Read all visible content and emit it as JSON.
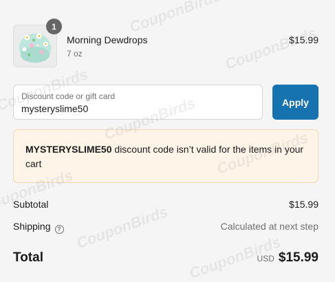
{
  "line_item": {
    "quantity": "1",
    "name": "Morning Dewdrops",
    "variant": "7 oz",
    "price": "$15.99",
    "thumbnail_icon": "slime-product-image"
  },
  "discount": {
    "label": "Discount code or gift card",
    "value": "mysteryslime50",
    "apply_label": "Apply"
  },
  "error": {
    "code": "MYSTERYSLIME50",
    "message": " discount code isn’t valid for the items in your cart"
  },
  "summary": {
    "subtotal_label": "Subtotal",
    "subtotal_value": "$15.99",
    "shipping_label": "Shipping",
    "shipping_help_icon": "question-circle-icon",
    "shipping_value": "Calculated at next step",
    "total_label": "Total",
    "currency": "USD",
    "total_value": "$15.99"
  },
  "watermark": "CouponBirds",
  "colors": {
    "accent": "#1773b0",
    "error_bg": "#fff4e8",
    "error_border": "#f7d5b5",
    "page_bg": "#f5f5f5"
  }
}
